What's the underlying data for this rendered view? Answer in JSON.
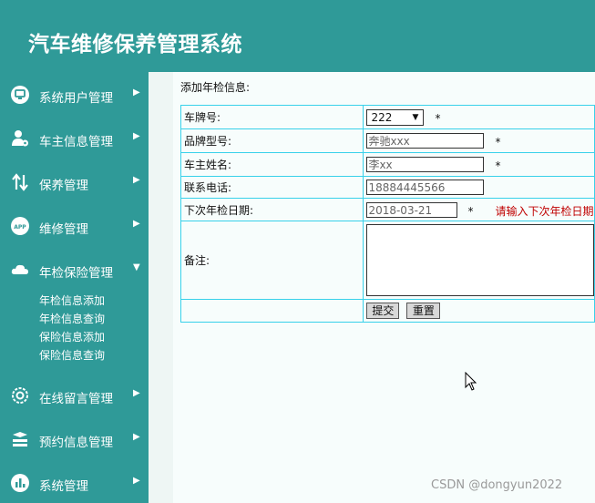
{
  "app": {
    "title": "汽车维修保养管理系统"
  },
  "sidebar": {
    "items": [
      {
        "label": "系统用户管理",
        "icon": "monitor-icon"
      },
      {
        "label": "车主信息管理",
        "icon": "user-gear-icon"
      },
      {
        "label": "保养管理",
        "icon": "swap-arrows-icon"
      },
      {
        "label": "维修管理",
        "icon": "app-icon"
      },
      {
        "label": "年检保险管理",
        "icon": "cloud-icon",
        "expanded": true
      },
      {
        "label": "在线留言管理",
        "icon": "settings-icon"
      },
      {
        "label": "预约信息管理",
        "icon": "layers-icon"
      },
      {
        "label": "系统管理",
        "icon": "bar-chart-icon"
      }
    ],
    "subitems": [
      "年检信息添加",
      "年检信息查询",
      "保险信息添加",
      "保险信息查询"
    ]
  },
  "form": {
    "title": "添加年检信息:",
    "plate_label": "车牌号:",
    "plate_value": "222",
    "model_label": "品牌型号:",
    "model_value": "奔驰xxx",
    "owner_label": "车主姓名:",
    "owner_value": "李xx",
    "phone_label": "联系电话:",
    "phone_value": "18884445566",
    "next_date_label": "下次年检日期:",
    "next_date_value": "2018-03-21",
    "next_date_hint": "请输入下次年检日期",
    "remark_label": "备注:",
    "required_mark": "*",
    "submit_label": "提交",
    "reset_label": "重置"
  },
  "watermark": "CSDN @dongyun2022",
  "colors": {
    "primary": "#2f9a98",
    "table_border": "#38d1ea",
    "hint": "#c00000"
  }
}
